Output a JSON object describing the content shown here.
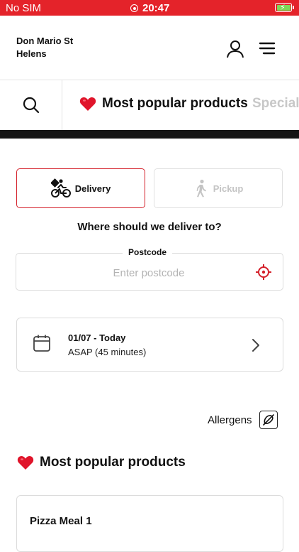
{
  "status_bar": {
    "carrier": "No SIM",
    "time": "20:47"
  },
  "header": {
    "store_name": "Don Mario St Helens"
  },
  "categories": {
    "active_label": "Most popular products",
    "next_label": "Specials",
    "heart_icon": "heart-icon"
  },
  "order_type": {
    "delivery_label": "Delivery",
    "pickup_label": "Pickup",
    "selected": "Delivery"
  },
  "delivery": {
    "question": "Where should we deliver to?",
    "postcode_label": "Postcode",
    "postcode_placeholder": "Enter postcode",
    "postcode_value": ""
  },
  "schedule": {
    "date": "01/07 - Today",
    "time": "ASAP (45 minutes)"
  },
  "allergens": {
    "label": "Allergens"
  },
  "section": {
    "title": "Most popular products"
  },
  "products": [
    {
      "name": "Pizza Meal 1",
      "description": ""
    }
  ],
  "colors": {
    "brand_red": "#e4232a",
    "accent_border": "#d4202a",
    "dark_bar": "#151515",
    "battery_green": "#7ed957"
  }
}
